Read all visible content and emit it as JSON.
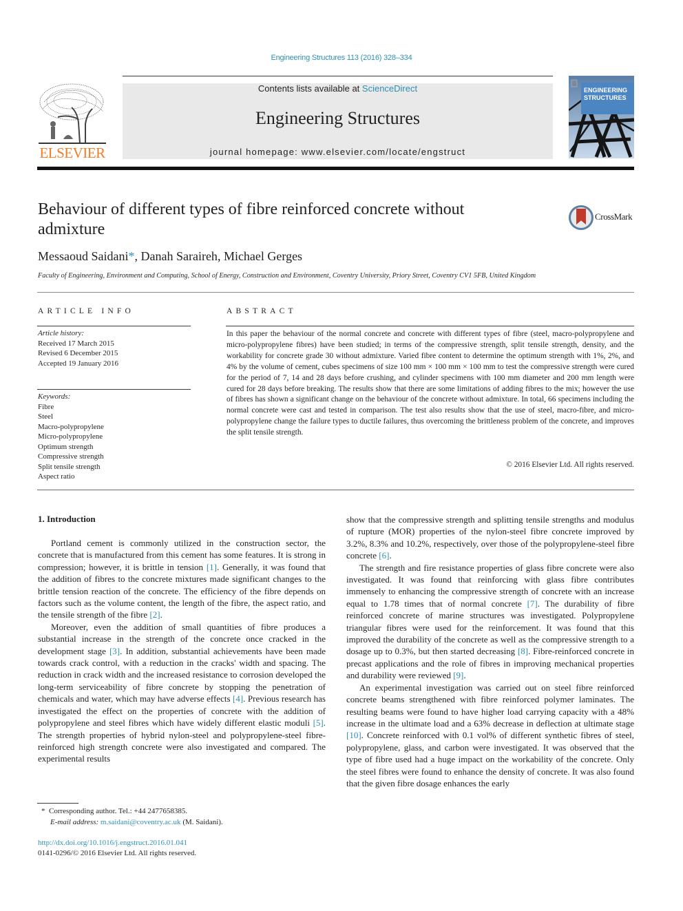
{
  "citation": "Engineering Structures 113 (2016) 328–334",
  "header": {
    "publisher_logo_text": "ELSEVIER",
    "contents_prefix": "Contents lists available at ",
    "contents_link": "ScienceDirect",
    "journal_title": "Engineering Structures",
    "homepage": "journal homepage: www.elsevier.com/locate/engstruct",
    "cover_title_line1": "ENGINEERING",
    "cover_title_line2": "STRUCTURES"
  },
  "article": {
    "title": "Behaviour of different types of fibre reinforced concrete without admixture",
    "crossmark_label": "CrossMark",
    "authors": [
      {
        "name": "Messaoud Saidani",
        "corresponding_mark": "*"
      },
      {
        "name": "Danah Saraireh"
      },
      {
        "name": "Michael Gerges"
      }
    ],
    "author_sep": ", ",
    "affiliation": "Faculty of Engineering, Environment and Computing, School of Energy, Construction and Environment, Coventry University, Priory Street, Coventry CV1 5FB, United Kingdom"
  },
  "article_info": {
    "heading": "ARTICLE INFO",
    "history_label": "Article history:",
    "history": [
      "Received 17 March 2015",
      "Revised 6 December 2015",
      "Accepted 19 January 2016"
    ],
    "keywords_label": "Keywords:",
    "keywords": [
      "Fibre",
      "Steel",
      "Macro-polypropylene",
      "Micro-polypropylene",
      "Optimum strength",
      "Compressive strength",
      "Split tensile strength",
      "Aspect ratio"
    ]
  },
  "abstract": {
    "heading": "ABSTRACT",
    "text": "In this paper the behaviour of the normal concrete and concrete with different types of fibre (steel, macro-polypropylene and micro-polypropylene fibres) have been studied; in terms of the compressive strength, split tensile strength, density, and the workability for concrete grade 30 without admixture. Varied fibre content to determine the optimum strength with 1%, 2%, and 4% by the volume of cement, cubes specimens of size 100 mm × 100 mm × 100 mm to test the compressive strength were cured for the period of 7, 14 and 28 days before crushing, and cylinder specimens with 100 mm diameter and 200 mm length were cured for 28 days before breaking. The results show that there are some limitations of adding fibres to the mix; however the use of fibres has shown a significant change on the behaviour of the concrete without admixture. In total, 66 specimens including the normal concrete were cast and tested in comparison. The test also results show that the use of steel, macro-fibre, and micro-polypropylene change the failure types to ductile failures, thus overcoming the brittleness problem of the concrete, and improves the split tensile strength.",
    "copyright": "© 2016 Elsevier Ltd. All rights reserved."
  },
  "body": {
    "section_heading": "1. Introduction",
    "left_paragraphs": [
      {
        "indent": true,
        "parts": [
          {
            "t": "Portland cement is commonly utilized in the construction sector, the concrete that is manufactured from this cement has some features. It is strong in compression; however, it is brittle in tension "
          },
          {
            "ref": "[1]"
          },
          {
            "t": ". Generally, it was found that the addition of fibres to the concrete mixtures made significant changes to the brittle tension reaction of the concrete. The efficiency of the fibre depends on factors such as the volume content, the length of the fibre, the aspect ratio, and the tensile strength of the fibre "
          },
          {
            "ref": "[2]"
          },
          {
            "t": "."
          }
        ]
      },
      {
        "indent": true,
        "parts": [
          {
            "t": "Moreover, even the addition of small quantities of fibre produces a substantial increase in the strength of the concrete once cracked in the development stage "
          },
          {
            "ref": "[3]"
          },
          {
            "t": ". In addition, substantial achievements have been made towards crack control, with a reduction in the cracks' width and spacing. The reduction in crack width and the increased resistance to corrosion developed the long-term serviceability of fibre concrete by stopping the penetration of chemicals and water, which may have adverse effects "
          },
          {
            "ref": "[4]"
          },
          {
            "t": ". Previous research has investigated the effect on the properties of concrete with the addition of polypropylene and steel fibres which have widely different elastic moduli "
          },
          {
            "ref": "[5]"
          },
          {
            "t": ". The strength properties of hybrid nylon-steel and polypropylene-steel fibre-reinforced high strength concrete were also investigated and compared. The experimental results"
          }
        ]
      }
    ],
    "right_paragraphs": [
      {
        "indent": false,
        "parts": [
          {
            "t": "show that the compressive strength and splitting tensile strengths and modulus of rupture (MOR) properties of the nylon-steel fibre concrete improved by 3.2%, 8.3% and 10.2%, respectively, over those of the polypropylene-steel fibre concrete "
          },
          {
            "ref": "[6]"
          },
          {
            "t": "."
          }
        ]
      },
      {
        "indent": true,
        "parts": [
          {
            "t": "The strength and fire resistance properties of glass fibre concrete were also investigated. It was found that reinforcing with glass fibre contributes immensely to enhancing the compressive strength of concrete with an increase equal to 1.78 times that of normal concrete "
          },
          {
            "ref": "[7]"
          },
          {
            "t": ". The durability of fibre reinforced concrete of marine structures was investigated. Polypropylene triangular fibres were used for the reinforcement. It was found that this improved the durability of the concrete as well as the compressive strength to a dosage up to 0.3%, but then started decreasing "
          },
          {
            "ref": "[8]"
          },
          {
            "t": ". Fibre-reinforced concrete in precast applications and the role of fibres in improving mechanical properties and durability were reviewed "
          },
          {
            "ref": "[9]"
          },
          {
            "t": "."
          }
        ]
      },
      {
        "indent": true,
        "parts": [
          {
            "t": "An experimental investigation was carried out on steel fibre reinforced concrete beams strengthened with fibre reinforced polymer laminates. The resulting beams were found to have higher load carrying capacity with a 48% increase in the ultimate load and a 63% decrease in deflection at ultimate stage "
          },
          {
            "ref": "[10]"
          },
          {
            "t": ". Concrete reinforced with 0.1 vol% of different synthetic fibres of steel, polypropylene, glass, and carbon were investigated. It was observed that the type of fibre used had a huge impact on the workability of the concrete. Only the steel fibres were found to enhance the density of concrete. It was also found that the given fibre dosage enhances the early"
          }
        ]
      }
    ]
  },
  "footnote": {
    "mark": "*",
    "corresponding": "Corresponding author. Tel.: +44 2477658385.",
    "email_label": "E-mail address:",
    "email": "m.saidani@coventry.ac.uk",
    "email_suffix": " (M. Saidani).",
    "doi": "http://dx.doi.org/10.1016/j.engstruct.2016.01.041",
    "issn_copyright": "0141-0296/© 2016 Elsevier Ltd. All rights reserved."
  },
  "colors": {
    "link": "#2e8fb5",
    "elsevier_orange": "#f47b20",
    "masthead_bg": "#e9e9e9",
    "crossmark_red": "#c0392b"
  }
}
